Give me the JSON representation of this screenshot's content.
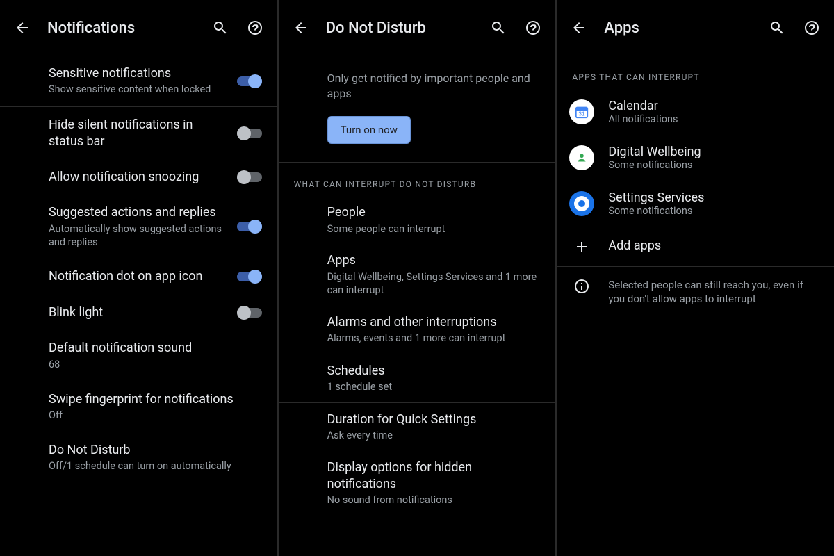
{
  "panel1": {
    "title": "Notifications",
    "items": [
      {
        "title": "Sensitive notifications",
        "sub": "Show sensitive content when locked",
        "toggle": true
      },
      {
        "title": "Hide silent notifications in status bar",
        "toggle": false
      },
      {
        "title": "Allow notification snoozing",
        "toggle": false
      },
      {
        "title": "Suggested actions and replies",
        "sub": "Automatically show suggested actions and replies",
        "toggle": true
      },
      {
        "title": "Notification dot on app icon",
        "toggle": true
      },
      {
        "title": "Blink light",
        "toggle": false
      },
      {
        "title": "Default notification sound",
        "sub": "68"
      },
      {
        "title": "Swipe fingerprint for notifications",
        "sub": "Off"
      },
      {
        "title": "Do Not Disturb",
        "sub": "Off/1 schedule can turn on automatically"
      }
    ]
  },
  "panel2": {
    "title": "Do Not Disturb",
    "intro": "Only get notified by important people and apps",
    "turn_on": "Turn on now",
    "section": "What can interrupt Do Not Disturb",
    "items": [
      {
        "title": "People",
        "sub": "Some people can interrupt"
      },
      {
        "title": "Apps",
        "sub": "Digital Wellbeing, Settings Services and 1 more can interrupt"
      },
      {
        "title": "Alarms and other interruptions",
        "sub": "Alarms, events and 1 more can interrupt"
      }
    ],
    "schedules": {
      "title": "Schedules",
      "sub": "1 schedule set"
    },
    "duration": {
      "title": "Duration for Quick Settings",
      "sub": "Ask every time"
    },
    "display_options": {
      "title": "Display options for hidden notifications",
      "sub": "No sound from notifications"
    }
  },
  "panel3": {
    "title": "Apps",
    "section": "Apps that can interrupt",
    "apps": [
      {
        "name": "Calendar",
        "sub": "All notifications"
      },
      {
        "name": "Digital Wellbeing",
        "sub": "Some notifications"
      },
      {
        "name": "Settings Services",
        "sub": "Some notifications"
      }
    ],
    "add": "Add apps",
    "info": "Selected people can still reach you, even if you don't allow apps to interrupt"
  }
}
